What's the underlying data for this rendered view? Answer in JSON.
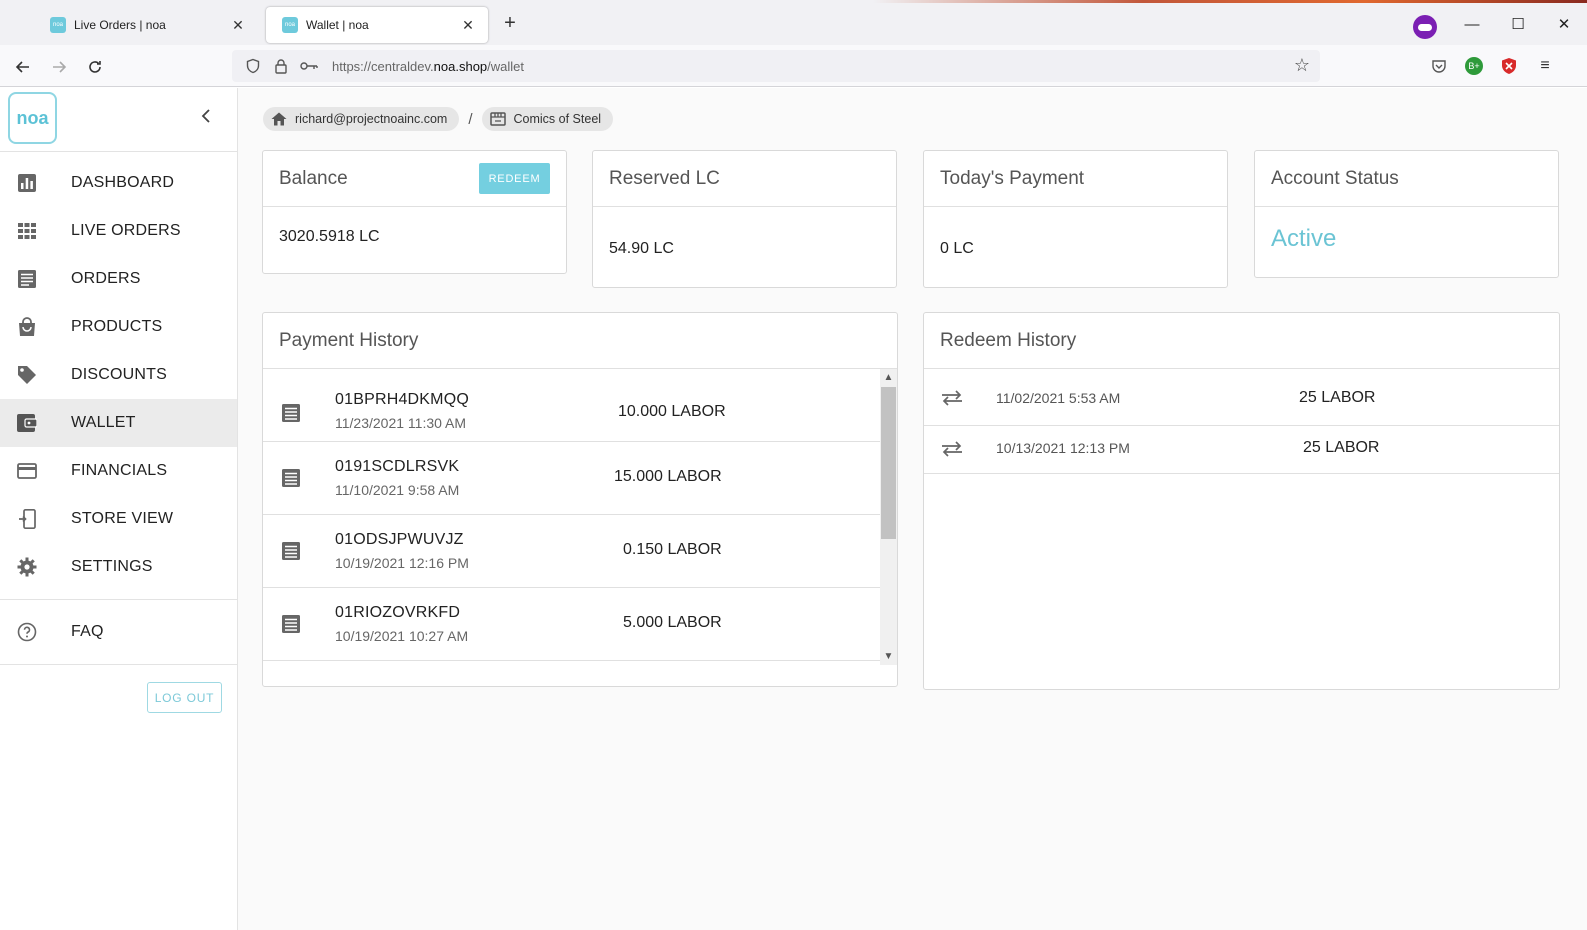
{
  "browser": {
    "tabs": [
      {
        "title": "Live Orders | noa",
        "favicon": "noa"
      },
      {
        "title": "Wallet | noa",
        "favicon": "noa"
      }
    ],
    "url_prefix": "https://centraldev.",
    "url_domain": "noa.shop",
    "url_path": "/wallet"
  },
  "sidebar": {
    "logo": "noa",
    "items": [
      {
        "label": "DASHBOARD",
        "icon": "bar-chart-icon"
      },
      {
        "label": "LIVE ORDERS",
        "icon": "grid-icon"
      },
      {
        "label": "ORDERS",
        "icon": "list-icon"
      },
      {
        "label": "PRODUCTS",
        "icon": "shopping-bag-icon"
      },
      {
        "label": "DISCOUNTS",
        "icon": "tag-icon"
      },
      {
        "label": "WALLET",
        "icon": "wallet-icon"
      },
      {
        "label": "FINANCIALS",
        "icon": "credit-card-icon"
      },
      {
        "label": "STORE VIEW",
        "icon": "phone-link-icon"
      },
      {
        "label": "SETTINGS",
        "icon": "gear-icon"
      }
    ],
    "faq": {
      "label": "FAQ",
      "icon": "help-circle-icon"
    },
    "logout_label": "LOG OUT"
  },
  "breadcrumb": {
    "user": "richard@projectnoainc.com",
    "store": "Comics of Steel",
    "separator": "/"
  },
  "cards": {
    "balance": {
      "title": "Balance",
      "value": "3020.5918 LC",
      "button": "REDEEM"
    },
    "reserved": {
      "title": "Reserved LC",
      "value": "54.90 LC"
    },
    "today": {
      "title": "Today's Payment",
      "value": "0 LC"
    },
    "status": {
      "title": "Account Status",
      "value": "Active"
    }
  },
  "payment_history": {
    "title": "Payment History",
    "rows": [
      {
        "id": "01BPRH4DKMQQ",
        "date": "11/23/2021 11:30 AM",
        "amount": "10.000 LABOR"
      },
      {
        "id": "0191SCDLRSVK",
        "date": "11/10/2021 9:58 AM",
        "amount": "15.000 LABOR"
      },
      {
        "id": "01ODSJPWUVJZ",
        "date": "10/19/2021 12:16 PM",
        "amount": "0.150 LABOR"
      },
      {
        "id": "01RIOZOVRKFD",
        "date": "10/19/2021 10:27 AM",
        "amount": "5.000 LABOR"
      }
    ]
  },
  "redeem_history": {
    "title": "Redeem History",
    "rows": [
      {
        "date": "11/02/2021 5:53 AM",
        "amount": "25 LABOR"
      },
      {
        "date": "10/13/2021 12:13 PM",
        "amount": "25 LABOR"
      }
    ]
  }
}
